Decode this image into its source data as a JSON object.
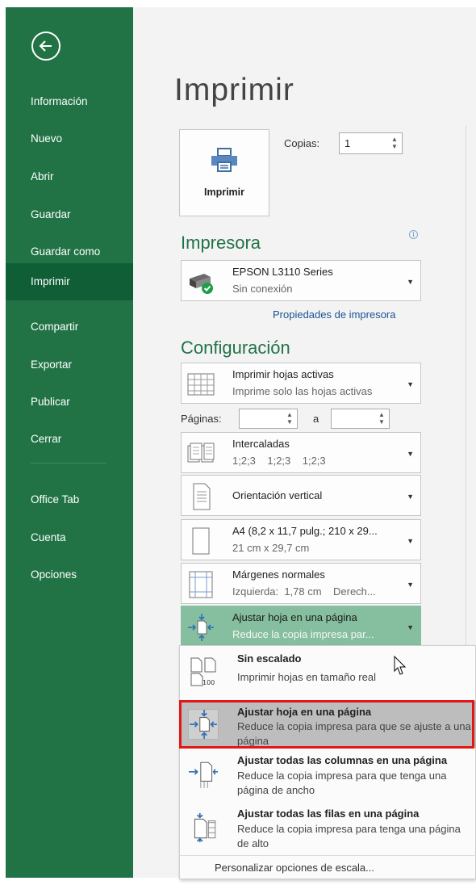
{
  "sidebar": {
    "back_icon": "back-arrow-icon",
    "items": [
      {
        "label": "Información"
      },
      {
        "label": "Nuevo"
      },
      {
        "label": "Abrir"
      },
      {
        "label": "Guardar"
      },
      {
        "label": "Guardar como"
      },
      {
        "label": "Imprimir",
        "active": true
      },
      {
        "label": "Compartir"
      },
      {
        "label": "Exportar"
      },
      {
        "label": "Publicar"
      },
      {
        "label": "Cerrar"
      },
      {
        "label": "Office Tab"
      },
      {
        "label": "Cuenta"
      },
      {
        "label": "Opciones"
      }
    ]
  },
  "main": {
    "title": "Imprimir",
    "print_button": "Imprimir",
    "copies_label": "Copias:",
    "copies_value": "1",
    "printer_section": "Impresora",
    "printer": {
      "name": "EPSON L3110 Series",
      "status": "Sin conexión"
    },
    "printer_props_link": "Propiedades de impresora",
    "config_section": "Configuración",
    "settings": [
      {
        "line1": "Imprimir hojas activas",
        "line2": "Imprime solo las hojas activas"
      },
      {
        "line1": "Intercaladas",
        "line2": "1;2;3    1;2;3    1;2;3"
      },
      {
        "line1": "Orientación vertical"
      },
      {
        "line1": "A4 (8,2 x 11,7 pulg.; 210 x 29...",
        "line2": "21 cm x 29,7 cm"
      },
      {
        "line1": "Márgenes normales",
        "line2": "Izquierda:  1,78 cm    Derech..."
      },
      {
        "line1": "Ajustar hoja en una página",
        "line2": "Reduce la copia impresa par..."
      }
    ],
    "pages_label": "Páginas:",
    "pages_to_label": "a"
  },
  "scaling_menu": {
    "options": [
      {
        "title": "Sin escalado",
        "desc": "Imprimir hojas en tamaño real",
        "icon": "no-scaling-icon",
        "icon_text": "100"
      },
      {
        "title": "Ajustar hoja en una página",
        "desc": "Reduce la copia impresa para que se ajuste a una página",
        "icon": "fit-sheet-icon",
        "selected": true
      },
      {
        "title": "Ajustar todas las columnas en una página",
        "desc": "Reduce la copia impresa para que tenga una página de ancho",
        "icon": "fit-columns-icon"
      },
      {
        "title": "Ajustar todas las filas en una página",
        "desc": "Reduce la copia impresa para tenga una página de alto",
        "icon": "fit-rows-icon"
      }
    ],
    "custom": "Personalizar opciones de escala..."
  },
  "colors": {
    "accent": "#217346",
    "active": "#0f5e35",
    "highlight_border": "#e21818"
  }
}
